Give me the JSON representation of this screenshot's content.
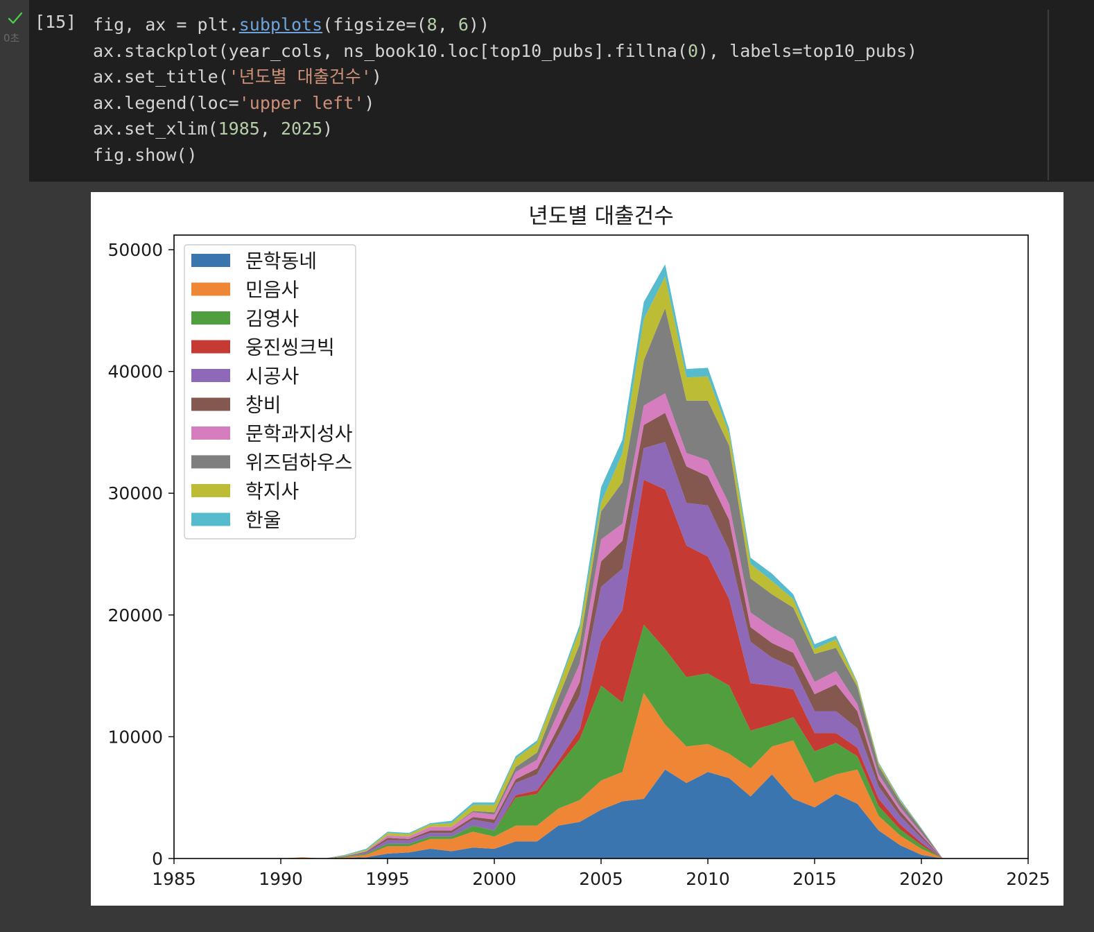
{
  "cell": {
    "status_icon": "checkmark-icon",
    "exec_time": "0초",
    "prompt": "[15]",
    "code_lines": [
      [
        {
          "t": "fig, ax = plt."
        },
        {
          "t": "subplots",
          "c": "link"
        },
        {
          "t": "(figsize=("
        },
        {
          "t": "8",
          "c": "num"
        },
        {
          "t": ", "
        },
        {
          "t": "6",
          "c": "num"
        },
        {
          "t": "))"
        }
      ],
      [
        {
          "t": "ax.stackplot(year_cols, ns_book10.loc[top10_pubs].fillna("
        },
        {
          "t": "0",
          "c": "num"
        },
        {
          "t": "), labels=top10_pubs)"
        }
      ],
      [
        {
          "t": "ax.set_title("
        },
        {
          "t": "'년도별 대출건수'",
          "c": "str"
        },
        {
          "t": ")"
        }
      ],
      [
        {
          "t": "ax.legend(loc="
        },
        {
          "t": "'upper left'",
          "c": "str"
        },
        {
          "t": ")"
        }
      ],
      [
        {
          "t": "ax.set_xlim("
        },
        {
          "t": "1985",
          "c": "num"
        },
        {
          "t": ", "
        },
        {
          "t": "2025",
          "c": "num"
        },
        {
          "t": ")"
        }
      ],
      [
        {
          "t": "fig.show()"
        }
      ]
    ],
    "colors": {
      "check": "#4ec94e",
      "string": "#ce9178",
      "number": "#b5cea8",
      "link": "#6fa3dc"
    }
  },
  "chart_data": {
    "type": "area",
    "stacked": true,
    "title": "년도별 대출건수",
    "xlabel": "",
    "ylabel": "",
    "xlim": [
      1985,
      2025
    ],
    "ylim": [
      0,
      51200
    ],
    "xticks": [
      1985,
      1990,
      1995,
      2000,
      2005,
      2010,
      2015,
      2020,
      2025
    ],
    "yticks": [
      0,
      10000,
      20000,
      30000,
      40000,
      50000
    ],
    "legend_position": "upper left",
    "grid": false,
    "x": [
      1988,
      1989,
      1990,
      1991,
      1992,
      1993,
      1994,
      1995,
      1996,
      1997,
      1998,
      1999,
      2000,
      2001,
      2002,
      2003,
      2004,
      2005,
      2006,
      2007,
      2008,
      2009,
      2010,
      2011,
      2012,
      2013,
      2014,
      2015,
      2016,
      2017,
      2018,
      2019,
      2020,
      2021
    ],
    "series": [
      {
        "name": "문학동네",
        "color": "#3b75af",
        "values": [
          0,
          0,
          0,
          0,
          0,
          50,
          100,
          400,
          500,
          800,
          600,
          900,
          800,
          1400,
          1400,
          2700,
          3000,
          4000,
          4700,
          4900,
          7300,
          6200,
          7100,
          6600,
          5100,
          6900,
          4900,
          4200,
          5300,
          4500,
          2300,
          1100,
          300,
          0
        ]
      },
      {
        "name": "민음사",
        "color": "#ef8636",
        "values": [
          0,
          0,
          0,
          100,
          0,
          50,
          200,
          600,
          500,
          800,
          1000,
          1300,
          1000,
          1300,
          1300,
          1400,
          1800,
          2400,
          2400,
          8700,
          3700,
          3000,
          2300,
          2000,
          2300,
          2300,
          4800,
          2000,
          1600,
          2800,
          1200,
          800,
          500,
          0
        ]
      },
      {
        "name": "김영사",
        "color": "#519e3e",
        "values": [
          0,
          0,
          0,
          0,
          0,
          50,
          100,
          200,
          200,
          200,
          200,
          500,
          500,
          2300,
          2600,
          3500,
          5000,
          7800,
          5700,
          5600,
          6200,
          5700,
          5800,
          5600,
          3100,
          1800,
          1900,
          2600,
          2600,
          1100,
          800,
          500,
          300,
          0
        ]
      },
      {
        "name": "웅진씽크빅",
        "color": "#c53a32",
        "values": [
          0,
          0,
          0,
          0,
          0,
          0,
          0,
          0,
          0,
          0,
          0,
          0,
          0,
          200,
          300,
          400,
          800,
          3600,
          7600,
          11900,
          13100,
          10800,
          9600,
          7100,
          3900,
          3200,
          2300,
          1500,
          800,
          700,
          600,
          400,
          200,
          0
        ]
      },
      {
        "name": "시공사",
        "color": "#8d69b8",
        "values": [
          0,
          0,
          0,
          0,
          0,
          50,
          100,
          300,
          300,
          300,
          300,
          500,
          600,
          1000,
          1300,
          2100,
          2800,
          4500,
          3400,
          2600,
          3900,
          3500,
          4200,
          4000,
          3400,
          2300,
          1800,
          1800,
          1800,
          1600,
          1000,
          700,
          400,
          0
        ]
      },
      {
        "name": "창비",
        "color": "#84584e",
        "values": [
          0,
          0,
          0,
          0,
          0,
          0,
          50,
          200,
          100,
          200,
          200,
          200,
          300,
          300,
          500,
          700,
          1100,
          2100,
          2300,
          1900,
          2400,
          3000,
          2400,
          2500,
          1200,
          1200,
          1200,
          1400,
          2200,
          1400,
          600,
          400,
          200,
          0
        ]
      },
      {
        "name": "문학과지성사",
        "color": "#d57dbe",
        "values": [
          0,
          0,
          0,
          0,
          0,
          0,
          50,
          200,
          200,
          300,
          300,
          400,
          400,
          600,
          700,
          1200,
          1500,
          1800,
          1400,
          1600,
          1600,
          1100,
          1300,
          1300,
          1200,
          1300,
          1100,
          1000,
          1100,
          600,
          400,
          300,
          200,
          0
        ]
      },
      {
        "name": "위즈덤하우스",
        "color": "#7f7f7f",
        "values": [
          0,
          0,
          0,
          0,
          0,
          0,
          0,
          0,
          0,
          0,
          0,
          100,
          200,
          400,
          600,
          1200,
          1600,
          2300,
          3400,
          3700,
          7000,
          4300,
          4900,
          4800,
          2800,
          2700,
          2600,
          2300,
          1900,
          1400,
          700,
          500,
          300,
          0
        ]
      },
      {
        "name": "학지사",
        "color": "#bcbc35",
        "values": [
          0,
          0,
          0,
          0,
          0,
          50,
          100,
          200,
          200,
          200,
          300,
          500,
          600,
          700,
          800,
          900,
          1200,
          700,
          2400,
          3400,
          2600,
          1900,
          2000,
          1000,
          1200,
          1100,
          700,
          400,
          700,
          300,
          200,
          100,
          50,
          0
        ]
      },
      {
        "name": "한울",
        "color": "#56bbcc",
        "values": [
          0,
          0,
          0,
          0,
          0,
          50,
          100,
          100,
          100,
          100,
          200,
          200,
          200,
          200,
          200,
          200,
          400,
          1300,
          1100,
          1400,
          1000,
          700,
          700,
          400,
          500,
          600,
          400,
          400,
          300,
          100,
          100,
          100,
          50,
          0
        ]
      }
    ]
  }
}
